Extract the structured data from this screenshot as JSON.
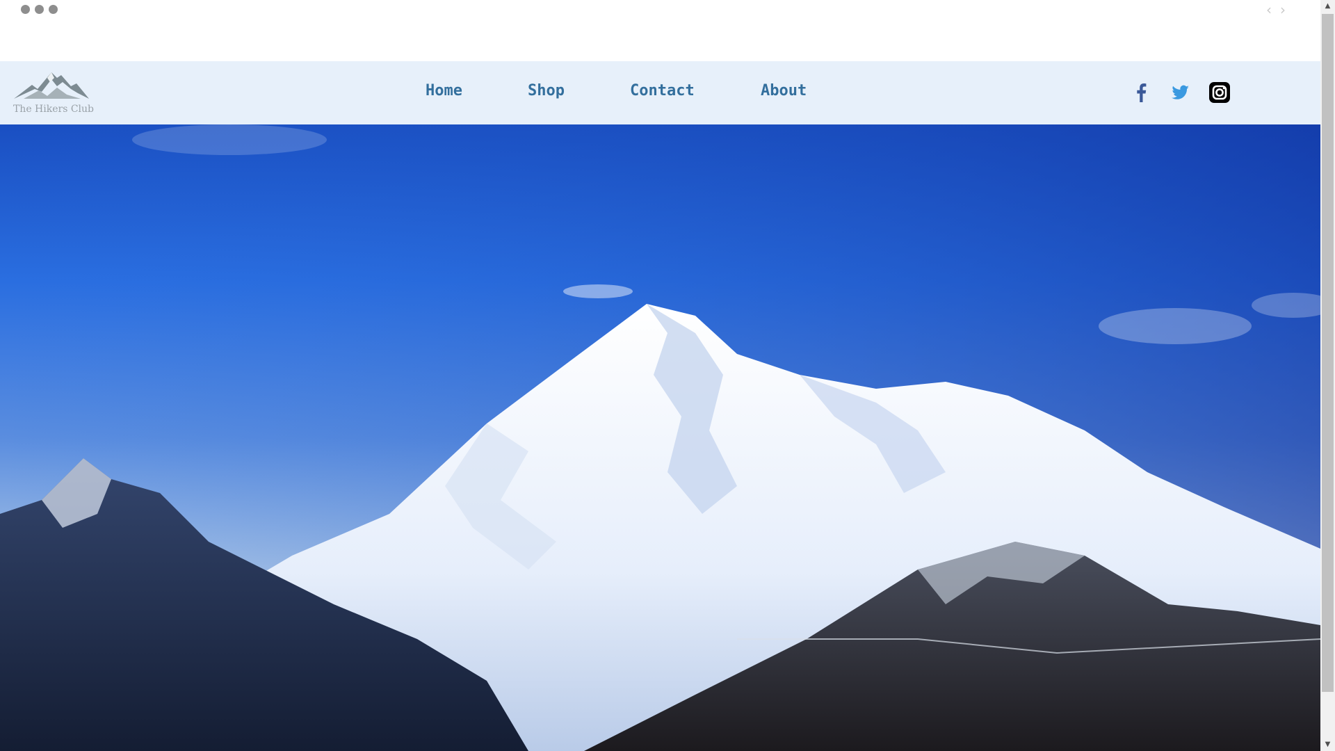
{
  "carousel": {
    "indicator_count": 3,
    "prev_icon": "chevron-left-icon",
    "next_icon": "chevron-right-icon",
    "prev_glyph": "‹",
    "next_glyph": "›"
  },
  "header": {
    "logo_text": "The Hikers Club",
    "nav": [
      {
        "label": "Home"
      },
      {
        "label": "Shop"
      },
      {
        "label": "Contact"
      },
      {
        "label": "About"
      }
    ],
    "social": [
      {
        "name": "facebook-icon",
        "color": "#3b5998"
      },
      {
        "name": "twitter-icon",
        "color": "#3a99e0"
      },
      {
        "name": "instagram-icon",
        "color": "#000000"
      }
    ]
  },
  "hero": {
    "image": "snow-capped mountain under blue sky"
  },
  "colors": {
    "navbar_bg": "#e7f0fa",
    "nav_link": "#336f9d",
    "sky_top": "#1a4fc2",
    "sky_bottom": "#a9c4e6"
  }
}
